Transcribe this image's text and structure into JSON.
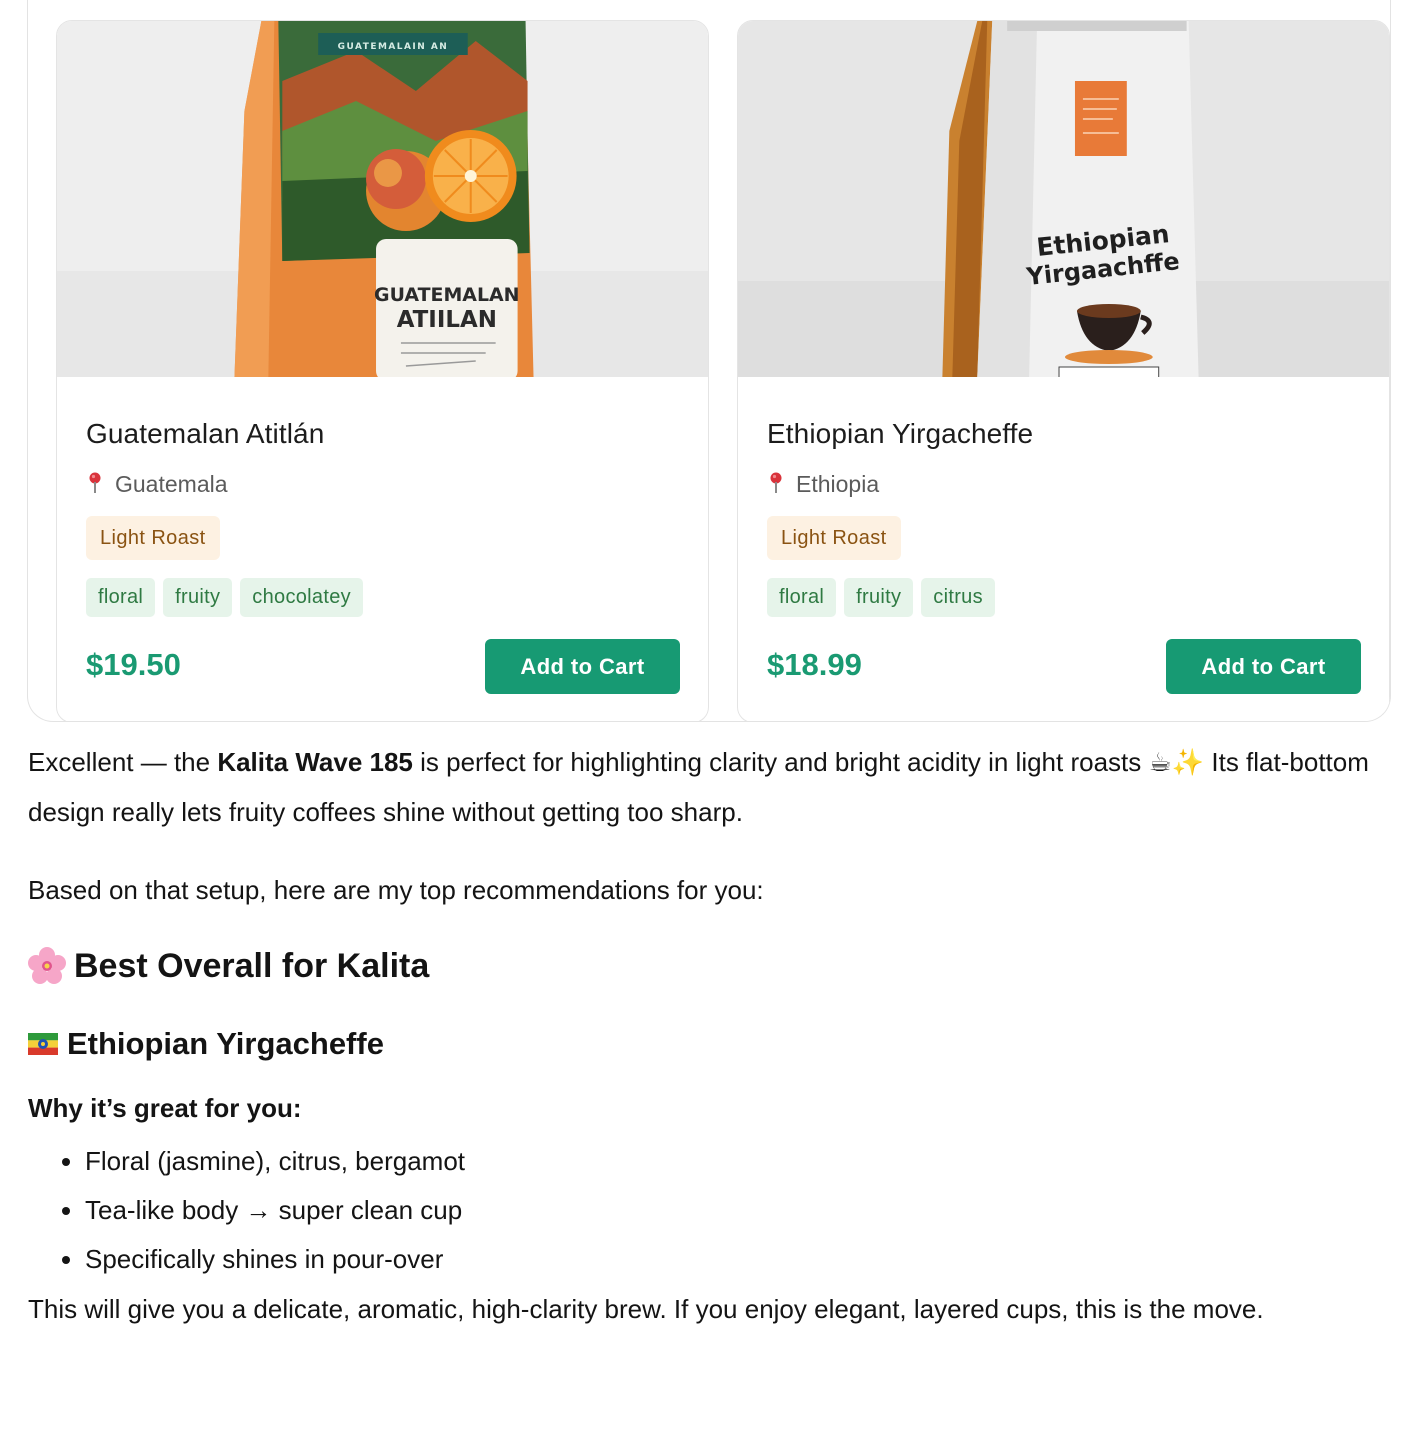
{
  "products": [
    {
      "name": "Guatemalan Atitlán",
      "origin": "Guatemala",
      "roast": "Light Roast",
      "tags": [
        "floral",
        "fruity",
        "chocolatey"
      ],
      "price": "$19.50",
      "button_label": "Add to Cart",
      "bag_label_lines": [
        "GUATEMALAN",
        "ATIILAN"
      ],
      "bag_top_label": "GUATEMALAIN AN"
    },
    {
      "name": "Ethiopian Yirgacheffe",
      "origin": "Ethiopia",
      "roast": "Light Roast",
      "tags": [
        "floral",
        "fruity",
        "citrus"
      ],
      "price": "$18.99",
      "button_label": "Add to Cart",
      "bag_label_lines": [
        "Ethiopian",
        "Yirgaachffe"
      ]
    }
  ],
  "message": {
    "intro_pre": "Excellent — the ",
    "intro_bold": "Kalita Wave 185",
    "intro_post": " is perfect for highlighting clarity and bright acidity in light roasts ☕✨ Its flat-bottom design really lets fruity coffees shine without getting too sharp.",
    "setup_line": "Based on that setup, here are my top recommendations for you:",
    "best_heading": "Best Overall for Kalita",
    "product_heading": "Ethiopian Yirgacheffe",
    "why_label": "Why it’s great for you:",
    "reasons": [
      "Floral (jasmine), citrus, bergamot",
      "Tea-like body → super clean cup",
      "Specifically shines in pour-over"
    ],
    "closing": "This will give you a delicate, aromatic, high-clarity brew. If you enjoy elegant, layered cups, this is the move."
  },
  "icons": {
    "location": "pin-icon",
    "best_heading": "cherry-blossom-icon",
    "product_heading": "ethiopia-flag-icon"
  },
  "colors": {
    "accent_green": "#179a73",
    "price_green": "#1a9a72",
    "roast_badge_bg": "#fdf1e2",
    "roast_badge_text": "#8a5312",
    "tag_bg": "#e6f4ea",
    "tag_text": "#2f7a43"
  }
}
